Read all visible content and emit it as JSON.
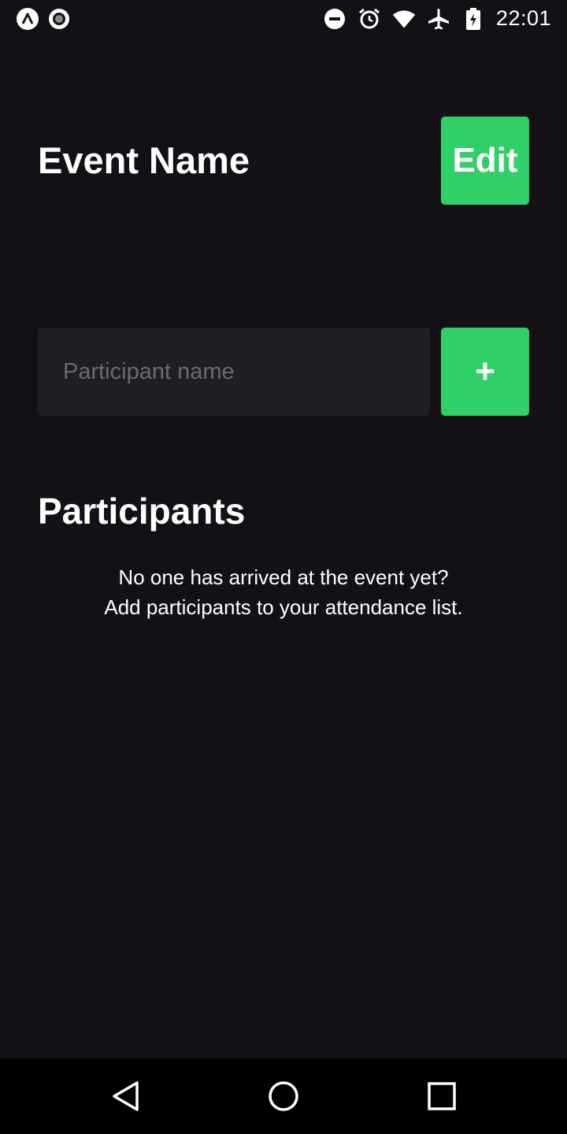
{
  "status_bar": {
    "time": "22:01",
    "left_icons": [
      "app-a-icon",
      "record-icon"
    ],
    "right_icons": [
      "do-not-disturb-icon",
      "alarm-icon",
      "wifi-icon",
      "airplane-icon",
      "battery-charging-icon"
    ]
  },
  "header": {
    "event_name": "Event Name",
    "edit_label": "Edit"
  },
  "form": {
    "placeholder": "Participant name",
    "value": "",
    "add_label": "+"
  },
  "participants": {
    "title": "Participants",
    "empty_line1": "No one has arrived at the event yet?",
    "empty_line2": "Add participants to your attendance list."
  },
  "nav_bar": {
    "buttons": [
      "back-icon",
      "home-icon",
      "recents-icon"
    ]
  },
  "colors": {
    "background": "#131016",
    "accent": "#31CF67",
    "input_bg": "#1F1E25",
    "placeholder": "#6B6B6B"
  }
}
